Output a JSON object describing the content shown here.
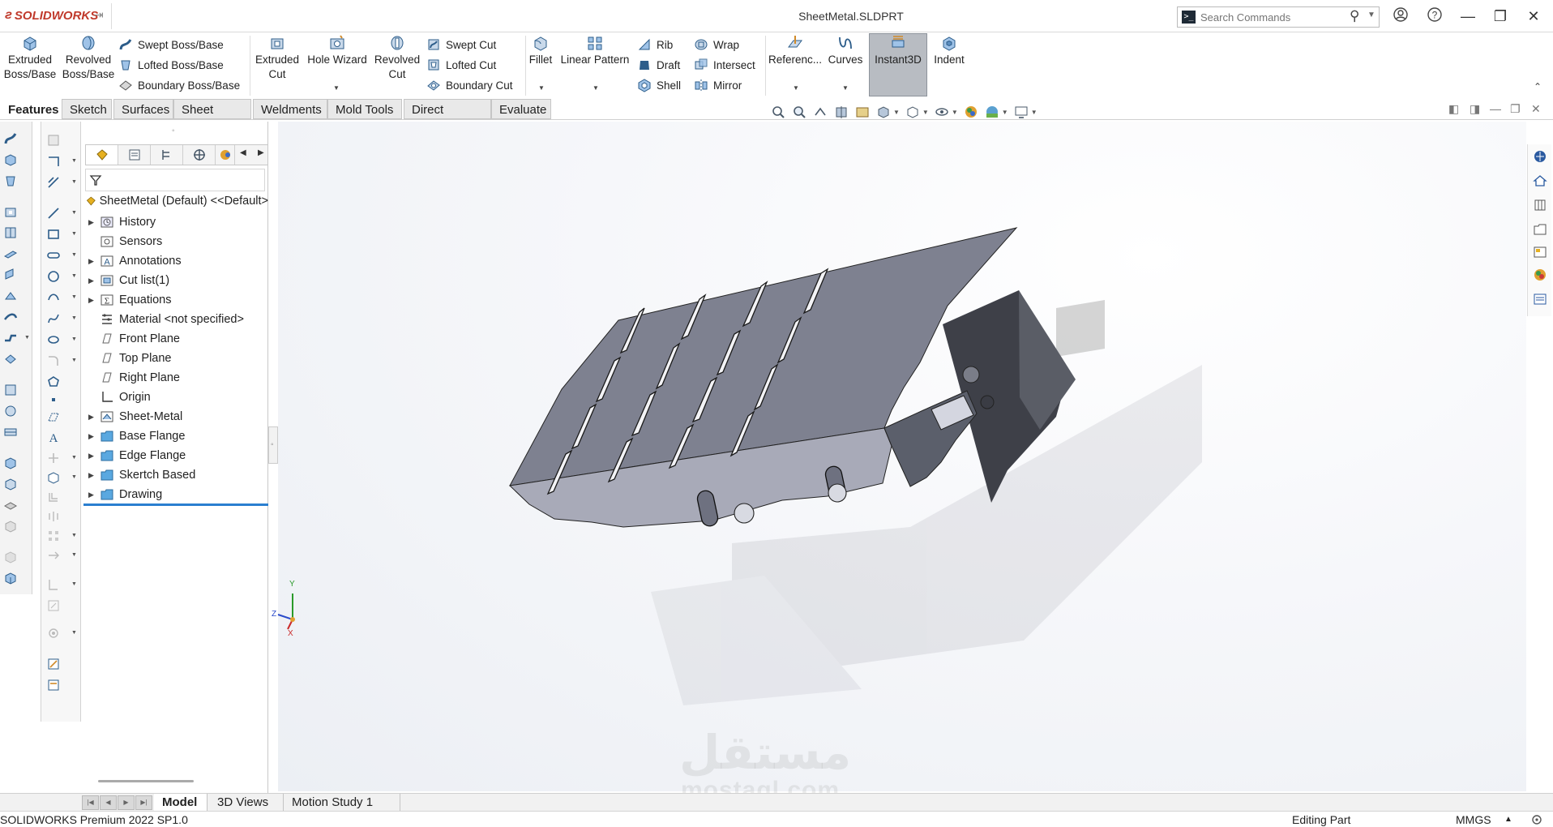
{
  "app": {
    "logo_text": "SOLIDWORKS",
    "document_title": "SheetMetal.SLDPRT"
  },
  "search": {
    "placeholder": "Search Commands"
  },
  "ribbon": {
    "extruded_boss": "Extruded\nBoss/Base",
    "revolved_boss": "Revolved\nBoss/Base",
    "swept_boss": "Swept Boss/Base",
    "lofted_boss": "Lofted Boss/Base",
    "boundary_boss": "Boundary Boss/Base",
    "extruded_cut": "Extruded\nCut",
    "hole_wizard": "Hole Wizard",
    "revolved_cut": "Revolved\nCut",
    "swept_cut": "Swept Cut",
    "lofted_cut": "Lofted Cut",
    "boundary_cut": "Boundary Cut",
    "fillet": "Fillet",
    "linear_pattern": "Linear Pattern",
    "rib": "Rib",
    "draft": "Draft",
    "shell": "Shell",
    "wrap": "Wrap",
    "intersect": "Intersect",
    "mirror": "Mirror",
    "reference": "Referenc...",
    "curves": "Curves",
    "instant3d": "Instant3D",
    "indent": "Indent"
  },
  "command_tabs": [
    "Features",
    "Sketch",
    "Surfaces",
    "Sheet Metal",
    "Weldments",
    "Mold Tools",
    "Direct Editing",
    "Evaluate"
  ],
  "feature_tree": {
    "root": "SheetMetal (Default) <<Default>",
    "items": [
      {
        "label": "History",
        "expandable": true,
        "icon": "history-icon"
      },
      {
        "label": "Sensors",
        "expandable": false,
        "icon": "sensors-icon"
      },
      {
        "label": "Annotations",
        "expandable": true,
        "icon": "annotations-icon"
      },
      {
        "label": "Cut list(1)",
        "expandable": true,
        "icon": "cut-list-icon"
      },
      {
        "label": "Equations",
        "expandable": true,
        "icon": "equations-icon"
      },
      {
        "label": "Material <not specified>",
        "expandable": false,
        "icon": "material-icon"
      },
      {
        "label": "Front Plane",
        "expandable": false,
        "icon": "plane-icon"
      },
      {
        "label": "Top Plane",
        "expandable": false,
        "icon": "plane-icon"
      },
      {
        "label": "Right Plane",
        "expandable": false,
        "icon": "plane-icon"
      },
      {
        "label": "Origin",
        "expandable": false,
        "icon": "origin-icon"
      },
      {
        "label": "Sheet-Metal",
        "expandable": true,
        "icon": "sheet-metal-icon"
      },
      {
        "label": "Base Flange",
        "expandable": true,
        "icon": "folder-icon"
      },
      {
        "label": "Edge Flange",
        "expandable": true,
        "icon": "folder-icon"
      },
      {
        "label": "Skertch Based",
        "expandable": true,
        "icon": "folder-icon"
      },
      {
        "label": "Drawing",
        "expandable": true,
        "icon": "folder-icon"
      }
    ]
  },
  "triad": {
    "y": "Y",
    "z": "Z",
    "x": "X"
  },
  "bottom_tabs": [
    "Model",
    "3D Views",
    "Motion Study 1"
  ],
  "status": {
    "product": "SOLIDWORKS Premium 2022 SP1.0",
    "mode": "Editing Part",
    "units": "MMGS"
  },
  "watermark": {
    "arabic": "مستقل",
    "latin": "mostaql.com"
  },
  "colors": {
    "accent": "#2a7fd0",
    "brand": "#c0392b",
    "instant3d_bg": "#b8bcc2"
  }
}
